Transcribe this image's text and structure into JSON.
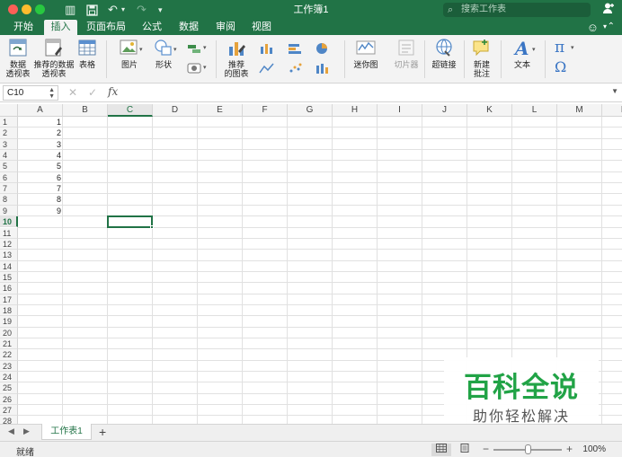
{
  "window": {
    "title": "工作簿1",
    "search_placeholder": "搜索工作表",
    "quick_access": [
      {
        "name": "sidebar-toggle-icon",
        "glyph": "▥"
      },
      {
        "name": "save-icon",
        "glyph": "💾"
      },
      {
        "name": "undo-icon",
        "glyph": "↶"
      },
      {
        "name": "redo-icon",
        "glyph": "↷"
      },
      {
        "name": "customize-toolbar-icon",
        "glyph": "▾"
      }
    ]
  },
  "ribbon_tabs": [
    "开始",
    "插入",
    "页面布局",
    "公式",
    "数据",
    "审阅",
    "视图"
  ],
  "active_tab": "插入",
  "ribbon": {
    "pivot_table": "数据\n透视表",
    "recommended_pivot": "推荐的数据\n透视表",
    "table": "表格",
    "pictures": "图片",
    "shapes": "形状",
    "recommended_charts": "推荐\n的图表",
    "sparklines": "迷你图",
    "slicer": "切片器",
    "hyperlink": "超链接",
    "new_comment": "新建\n批注",
    "text": "文本",
    "equation_glyph": "π",
    "symbol_glyph": "Ω"
  },
  "formula_bar": {
    "name_box": "C10",
    "cancel_glyph": "✕",
    "enter_glyph": "✓",
    "fx_label": "fx",
    "formula": ""
  },
  "sheet": {
    "columns": [
      "A",
      "B",
      "C",
      "D",
      "E",
      "F",
      "G",
      "H",
      "I",
      "J",
      "K",
      "L",
      "M",
      "N"
    ],
    "selected_column": "C",
    "rows": [
      "1",
      "2",
      "3",
      "4",
      "5",
      "6",
      "7",
      "8",
      "9",
      "10",
      "11",
      "12",
      "13",
      "14",
      "15",
      "16",
      "17",
      "18",
      "19",
      "20",
      "21",
      "22",
      "23",
      "24",
      "25",
      "26",
      "27",
      "28"
    ],
    "selected_row": "10",
    "column_a_values": [
      "1",
      "2",
      "3",
      "4",
      "5",
      "6",
      "7",
      "8",
      "9"
    ],
    "active_cell": "C10"
  },
  "watermark": {
    "line1": "百科全说",
    "line2": "助你轻松解决"
  },
  "sheet_tabs": {
    "tabs": [
      "工作表1"
    ],
    "add_glyph": "+"
  },
  "status": {
    "ready_text": "就绪",
    "zoom_label": "100%",
    "zoom_level_percent": 100
  },
  "colors": {
    "brand_green": "#217346",
    "watermark_green": "#21a346"
  }
}
